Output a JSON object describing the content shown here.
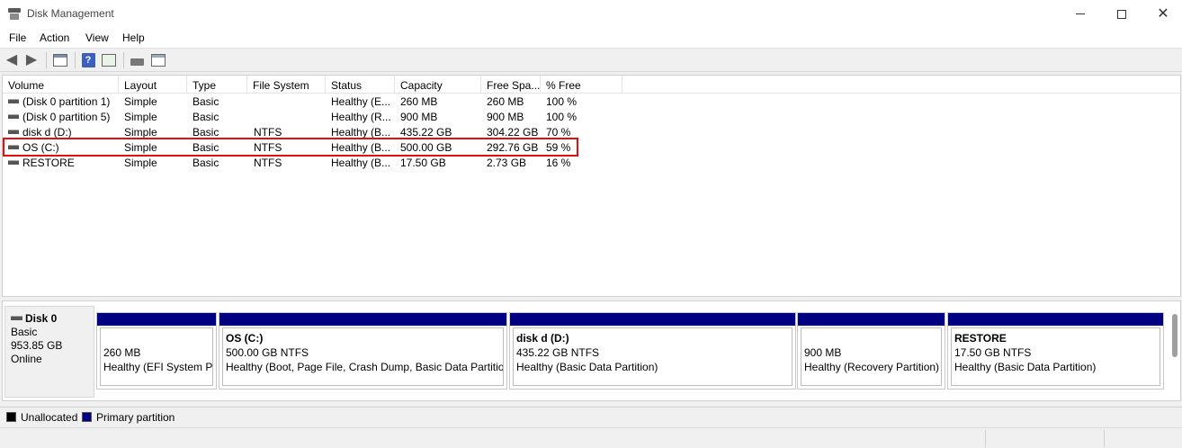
{
  "window": {
    "title": "Disk Management"
  },
  "menu": [
    "File",
    "Action",
    "View",
    "Help"
  ],
  "toolbar": {
    "icons": [
      "back-arrow-icon",
      "forward-arrow-icon",
      "properties-icon",
      "help-icon",
      "console-tree-icon",
      "disk-icon",
      "volume-list-icon"
    ]
  },
  "volume_list": {
    "columns": [
      "Volume",
      "Layout",
      "Type",
      "File System",
      "Status",
      "Capacity",
      "Free Spa...",
      "% Free"
    ],
    "rows": [
      {
        "volume": "(Disk 0 partition 1)",
        "layout": "Simple",
        "type": "Basic",
        "fs": "",
        "status": "Healthy (E...",
        "capacity": "260 MB",
        "free": "260 MB",
        "pct": "100 %"
      },
      {
        "volume": "(Disk 0 partition 5)",
        "layout": "Simple",
        "type": "Basic",
        "fs": "",
        "status": "Healthy (R...",
        "capacity": "900 MB",
        "free": "900 MB",
        "pct": "100 %"
      },
      {
        "volume": "disk d (D:)",
        "layout": "Simple",
        "type": "Basic",
        "fs": "NTFS",
        "status": "Healthy (B...",
        "capacity": "435.22 GB",
        "free": "304.22 GB",
        "pct": "70 %"
      },
      {
        "volume": "OS (C:)",
        "layout": "Simple",
        "type": "Basic",
        "fs": "NTFS",
        "status": "Healthy (B...",
        "capacity": "500.00 GB",
        "free": "292.76 GB",
        "pct": "59 %"
      },
      {
        "volume": "RESTORE",
        "layout": "Simple",
        "type": "Basic",
        "fs": "NTFS",
        "status": "Healthy (B...",
        "capacity": "17.50 GB",
        "free": "2.73 GB",
        "pct": "16 %"
      }
    ],
    "highlight_color": "#e01010"
  },
  "disk": {
    "name": "Disk 0",
    "type": "Basic",
    "size": "953.85 GB",
    "state": "Online",
    "partitions": [
      {
        "name": "",
        "size": "260 MB",
        "status": "Healthy (EFI System Pa"
      },
      {
        "name": "OS  (C:)",
        "size": "500.00 GB NTFS",
        "status": "Healthy (Boot, Page File, Crash Dump, Basic Data Partition"
      },
      {
        "name": "disk d  (D:)",
        "size": "435.22 GB NTFS",
        "status": "Healthy (Basic Data Partition)"
      },
      {
        "name": "",
        "size": "900 MB",
        "status": "Healthy (Recovery Partition)"
      },
      {
        "name": "RESTORE",
        "size": "17.50 GB NTFS",
        "status": "Healthy (Basic Data Partition)"
      }
    ]
  },
  "legend": {
    "unallocated": "Unallocated",
    "primary": "Primary partition",
    "unallocated_color": "#000000",
    "primary_color": "#000080"
  }
}
